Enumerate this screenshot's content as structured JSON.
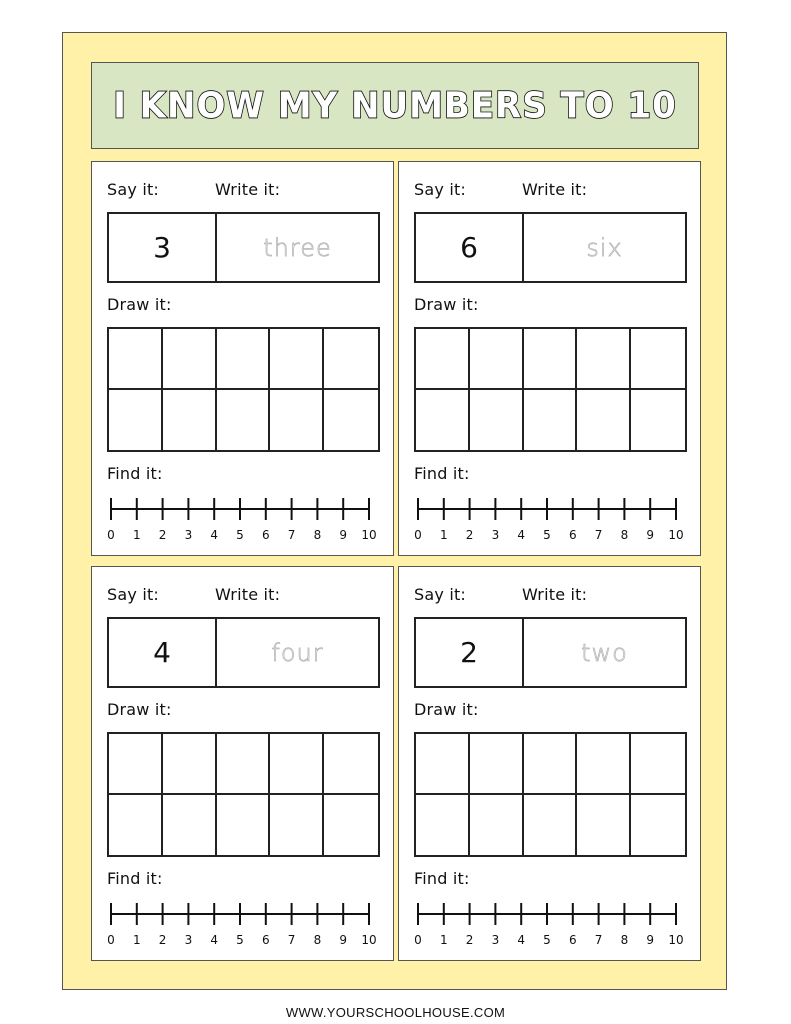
{
  "worksheet": {
    "title": "I KNOW MY NUMBERS TO 10",
    "colors": {
      "frame_background": "#fff1a8",
      "title_background": "#d9e6c4",
      "card_background": "#ffffff",
      "border": "#555555",
      "trace_text": "#b0b0b0"
    },
    "labels": {
      "say_it": "Say it:",
      "write_it": "Write it:",
      "draw_it": "Draw it:",
      "find_it": "Find it:"
    },
    "number_line": {
      "min": 0,
      "max": 10,
      "tick_labels": [
        "0",
        "1",
        "2",
        "3",
        "4",
        "5",
        "6",
        "7",
        "8",
        "9",
        "10"
      ]
    },
    "ten_frame_cells": 10,
    "cards": [
      {
        "number": "3",
        "word": "three"
      },
      {
        "number": "6",
        "word": "six"
      },
      {
        "number": "4",
        "word": "four"
      },
      {
        "number": "2",
        "word": "two"
      }
    ],
    "footer": "WWW.YOURSCHOOLHOUSE.COM"
  }
}
